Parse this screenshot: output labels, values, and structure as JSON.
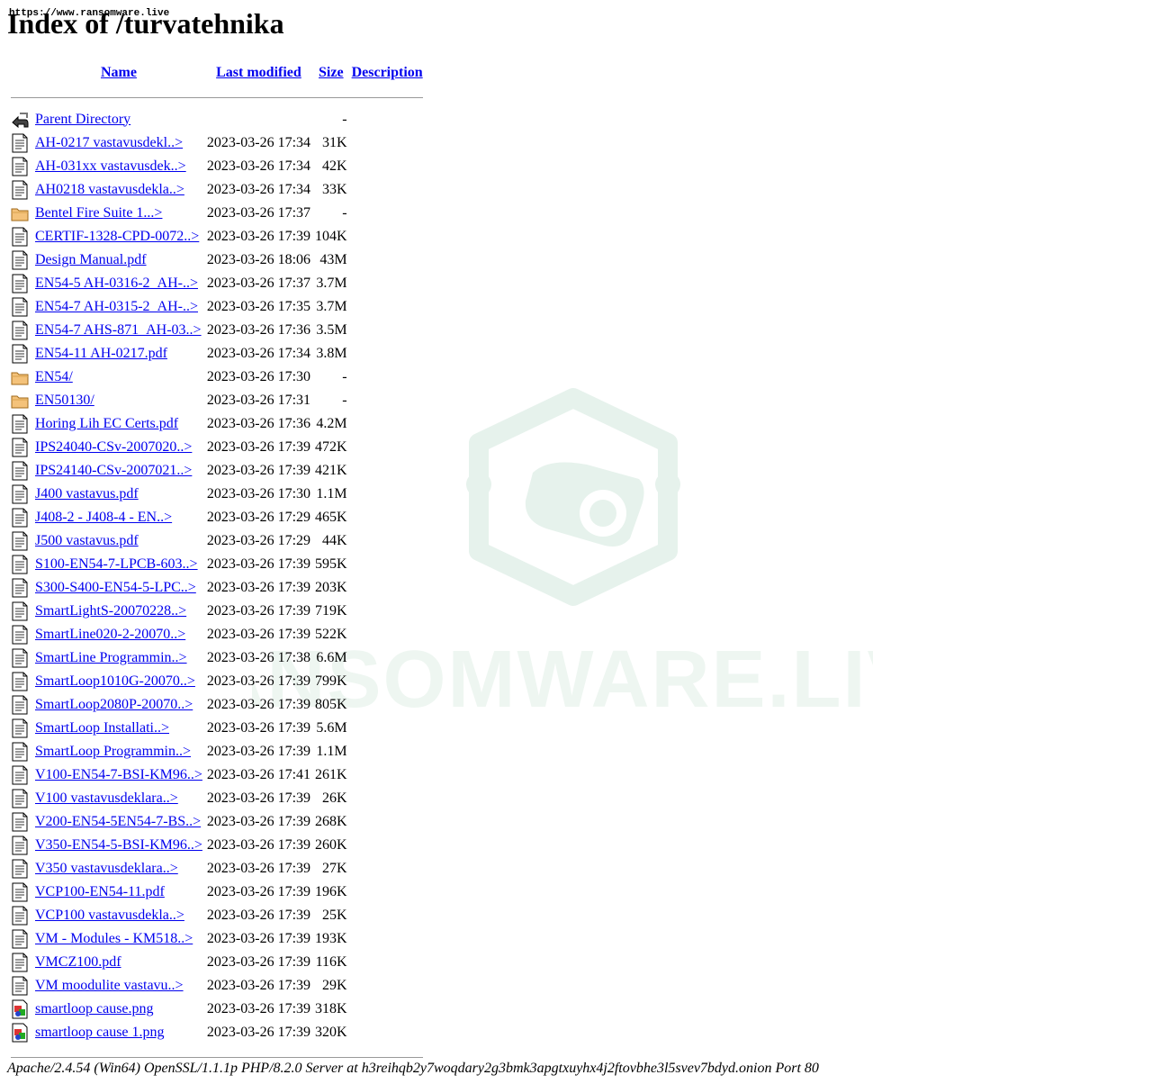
{
  "watermark_url": "https://www.ransomware.live",
  "page_title": "Index of /turvatehnika",
  "watermark_text": "RANSOMWARE.LIVE",
  "columns": {
    "name": "Name",
    "last_modified": "Last modified",
    "size": "Size",
    "description": "Description"
  },
  "parent": {
    "name": "Parent Directory",
    "size": "-",
    "icon": "back-icon"
  },
  "entries": [
    {
      "name": "AH-0217 vastavusdekl..>",
      "date": "2023-03-26 17:34",
      "size": "31K",
      "icon": "text-file-icon"
    },
    {
      "name": "AH-031xx vastavusdek..>",
      "date": "2023-03-26 17:34",
      "size": "42K",
      "icon": "text-file-icon"
    },
    {
      "name": "AH0218 vastavusdekla..>",
      "date": "2023-03-26 17:34",
      "size": "33K",
      "icon": "text-file-icon"
    },
    {
      "name": "Bentel Fire Suite 1...>",
      "date": "2023-03-26 17:37",
      "size": "-",
      "icon": "folder-icon"
    },
    {
      "name": "CERTIF-1328-CPD-0072..>",
      "date": "2023-03-26 17:39",
      "size": "104K",
      "icon": "text-file-icon"
    },
    {
      "name": "Design Manual.pdf",
      "date": "2023-03-26 18:06",
      "size": "43M",
      "icon": "text-file-icon"
    },
    {
      "name": "EN54-5 AH-0316-2_AH-..>",
      "date": "2023-03-26 17:37",
      "size": "3.7M",
      "icon": "text-file-icon"
    },
    {
      "name": "EN54-7 AH-0315-2_AH-..>",
      "date": "2023-03-26 17:35",
      "size": "3.7M",
      "icon": "text-file-icon"
    },
    {
      "name": "EN54-7 AHS-871_AH-03..>",
      "date": "2023-03-26 17:36",
      "size": "3.5M",
      "icon": "text-file-icon"
    },
    {
      "name": "EN54-11 AH-0217.pdf",
      "date": "2023-03-26 17:34",
      "size": "3.8M",
      "icon": "text-file-icon"
    },
    {
      "name": "EN54/",
      "date": "2023-03-26 17:30",
      "size": "-",
      "icon": "folder-icon"
    },
    {
      "name": "EN50130/",
      "date": "2023-03-26 17:31",
      "size": "-",
      "icon": "folder-icon"
    },
    {
      "name": "Horing Lih EC Certs.pdf",
      "date": "2023-03-26 17:36",
      "size": "4.2M",
      "icon": "text-file-icon"
    },
    {
      "name": "IPS24040-CSv-2007020..>",
      "date": "2023-03-26 17:39",
      "size": "472K",
      "icon": "text-file-icon"
    },
    {
      "name": "IPS24140-CSv-2007021..>",
      "date": "2023-03-26 17:39",
      "size": "421K",
      "icon": "text-file-icon"
    },
    {
      "name": "J400 vastavus.pdf",
      "date": "2023-03-26 17:30",
      "size": "1.1M",
      "icon": "text-file-icon"
    },
    {
      "name": "J408-2 - J408-4 - EN..>",
      "date": "2023-03-26 17:29",
      "size": "465K",
      "icon": "text-file-icon"
    },
    {
      "name": "J500 vastavus.pdf",
      "date": "2023-03-26 17:29",
      "size": "44K",
      "icon": "text-file-icon"
    },
    {
      "name": "S100-EN54-7-LPCB-603..>",
      "date": "2023-03-26 17:39",
      "size": "595K",
      "icon": "text-file-icon"
    },
    {
      "name": "S300-S400-EN54-5-LPC..>",
      "date": "2023-03-26 17:39",
      "size": "203K",
      "icon": "text-file-icon"
    },
    {
      "name": "SmartLightS-20070228..>",
      "date": "2023-03-26 17:39",
      "size": "719K",
      "icon": "text-file-icon"
    },
    {
      "name": "SmartLine020-2-20070..>",
      "date": "2023-03-26 17:39",
      "size": "522K",
      "icon": "text-file-icon"
    },
    {
      "name": "SmartLine Programmin..>",
      "date": "2023-03-26 17:38",
      "size": "6.6M",
      "icon": "text-file-icon"
    },
    {
      "name": "SmartLoop1010G-20070..>",
      "date": "2023-03-26 17:39",
      "size": "799K",
      "icon": "text-file-icon"
    },
    {
      "name": "SmartLoop2080P-20070..>",
      "date": "2023-03-26 17:39",
      "size": "805K",
      "icon": "text-file-icon"
    },
    {
      "name": "SmartLoop Installati..>",
      "date": "2023-03-26 17:39",
      "size": "5.6M",
      "icon": "text-file-icon"
    },
    {
      "name": "SmartLoop Programmin..>",
      "date": "2023-03-26 17:39",
      "size": "1.1M",
      "icon": "text-file-icon"
    },
    {
      "name": "V100-EN54-7-BSI-KM96..>",
      "date": "2023-03-26 17:41",
      "size": "261K",
      "icon": "text-file-icon"
    },
    {
      "name": "V100 vastavusdeklara..>",
      "date": "2023-03-26 17:39",
      "size": "26K",
      "icon": "text-file-icon"
    },
    {
      "name": "V200-EN54-5EN54-7-BS..>",
      "date": "2023-03-26 17:39",
      "size": "268K",
      "icon": "text-file-icon"
    },
    {
      "name": "V350-EN54-5-BSI-KM96..>",
      "date": "2023-03-26 17:39",
      "size": "260K",
      "icon": "text-file-icon"
    },
    {
      "name": "V350 vastavusdeklara..>",
      "date": "2023-03-26 17:39",
      "size": "27K",
      "icon": "text-file-icon"
    },
    {
      "name": "VCP100-EN54-11.pdf",
      "date": "2023-03-26 17:39",
      "size": "196K",
      "icon": "text-file-icon"
    },
    {
      "name": "VCP100 vastavusdekla..>",
      "date": "2023-03-26 17:39",
      "size": "25K",
      "icon": "text-file-icon"
    },
    {
      "name": "VM - Modules - KM518..>",
      "date": "2023-03-26 17:39",
      "size": "193K",
      "icon": "text-file-icon"
    },
    {
      "name": "VMCZ100.pdf",
      "date": "2023-03-26 17:39",
      "size": "116K",
      "icon": "text-file-icon"
    },
    {
      "name": "VM moodulite vastavu..>",
      "date": "2023-03-26 17:39",
      "size": "29K",
      "icon": "text-file-icon"
    },
    {
      "name": "smartloop cause.png",
      "date": "2023-03-26 17:39",
      "size": "318K",
      "icon": "image-file-icon"
    },
    {
      "name": "smartloop cause 1.png",
      "date": "2023-03-26 17:39",
      "size": "320K",
      "icon": "image-file-icon"
    }
  ],
  "footer": "Apache/2.4.54 (Win64) OpenSSL/1.1.1p PHP/8.2.0 Server at h3reihqb2y7woqdary2g3bmk3apgtxuyhx4j2ftovbhe3l5svev7bdyd.onion Port 80",
  "colors": {
    "link": "#0000ee",
    "watermark": "#e6f2ec",
    "rule": "#999999"
  }
}
